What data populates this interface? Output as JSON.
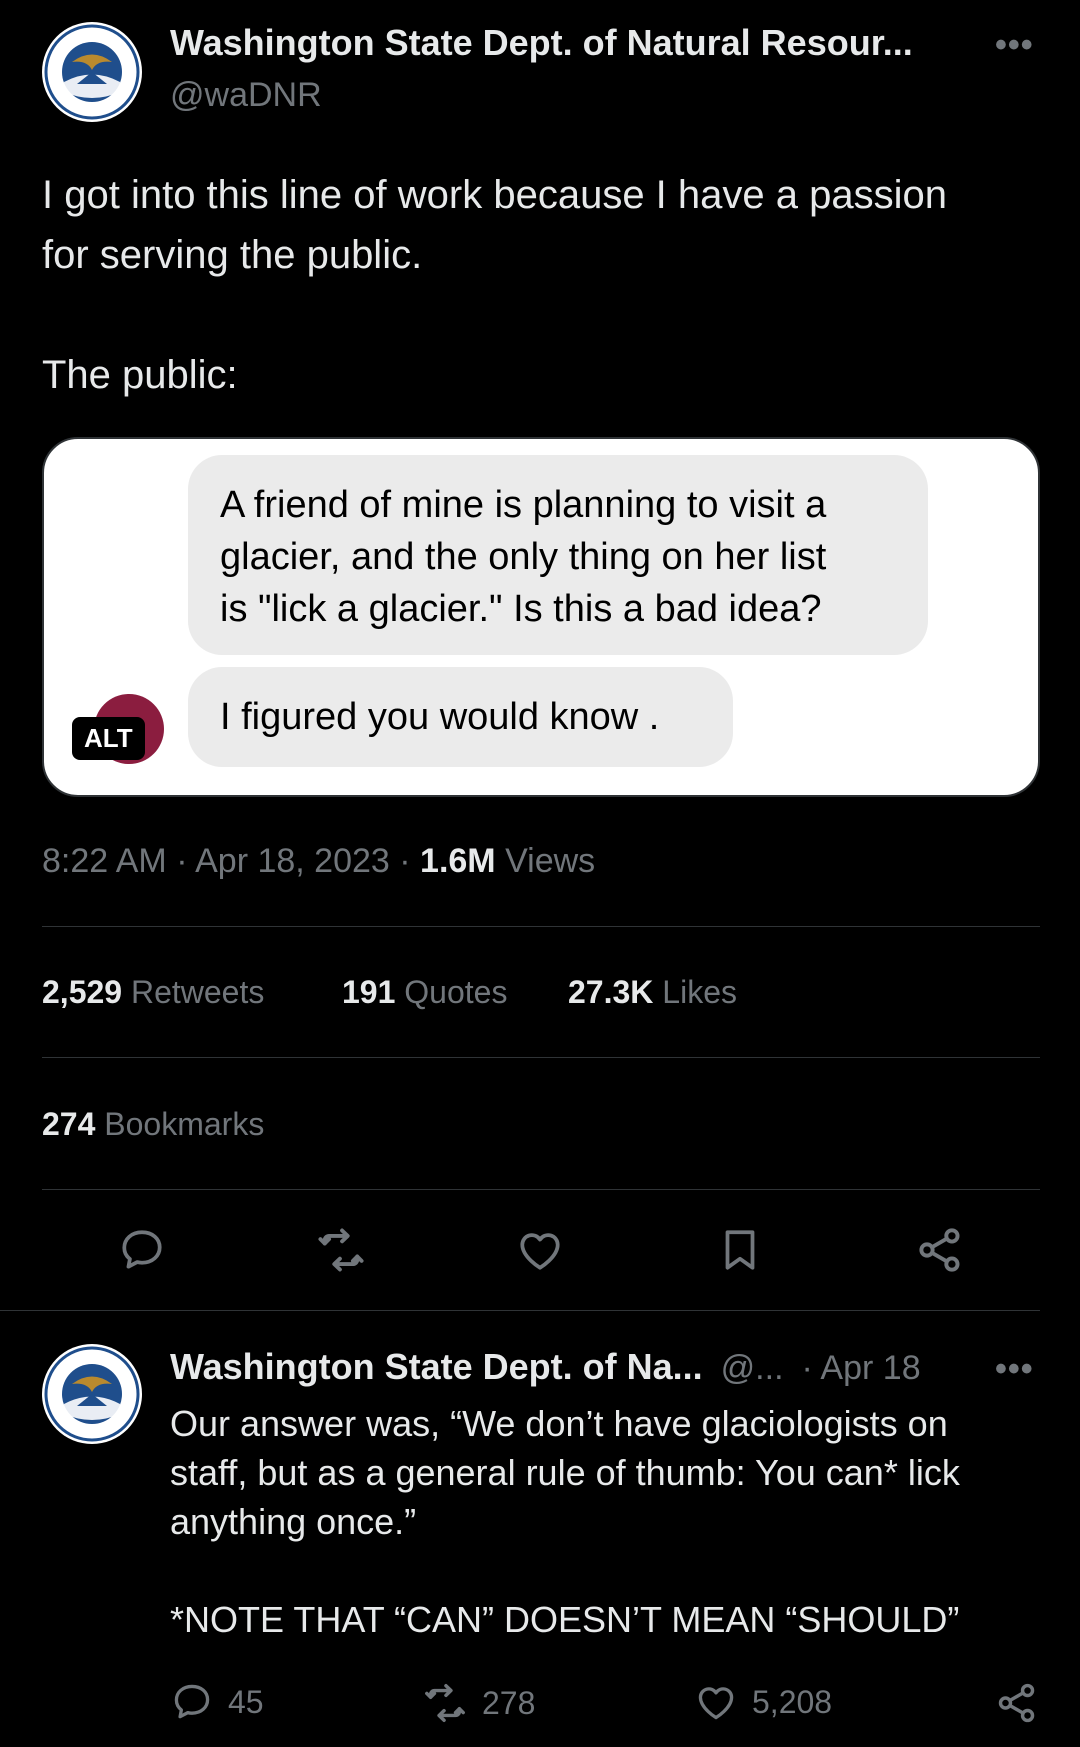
{
  "main_tweet": {
    "author_name": "Washington State Dept. of Natural Resour...",
    "handle": "@waDNR",
    "more": "•••",
    "text": "I got into this line of work because I have a passion\nfor serving the public.\n\nThe public:",
    "media": {
      "message_1": "A friend of mine is planning to visit a\nglacier, and the only thing on her list\nis \"lick a glacier.\" Is this a bad idea?",
      "message_2": "I figured you would know .",
      "alt_label": "ALT"
    },
    "time": "8:22 AM",
    "date": "Apr 18, 2023",
    "views_count": "1.6M",
    "views_label": "Views",
    "stats": {
      "retweets_count": "2,529",
      "retweets_label": "Retweets",
      "quotes_count": "191",
      "quotes_label": "Quotes",
      "likes_count": "27.3K",
      "likes_label": "Likes",
      "bookmarks_count": "274",
      "bookmarks_label": "Bookmarks"
    }
  },
  "reply": {
    "author_name": "Washington State Dept. of Na...",
    "handle": "@...",
    "date": "· Apr 18",
    "more": "•••",
    "text": "Our answer was, “We don’t have glaciologists on\nstaff, but as a general rule of thumb: You can* lick\nanything once.”\n\n*NOTE THAT “CAN” DOESN’T MEAN “SHOULD”",
    "reply_count": "45",
    "retweet_count": "278",
    "like_count": "5,208"
  },
  "icons": [
    "reply-icon",
    "retweet-icon",
    "like-icon",
    "bookmark-icon",
    "share-icon"
  ],
  "colors": {
    "background": "#000000",
    "text": "#e7e9ea",
    "muted": "#71767b",
    "divider": "#2f3336",
    "logo_blue": "#1f4e8c",
    "logo_gold": "#b98a2e",
    "avatar_dot": "#8b1d3f"
  }
}
